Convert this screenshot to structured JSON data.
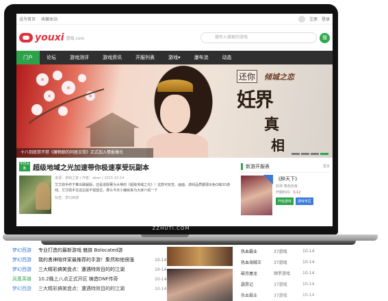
{
  "topbar": {
    "left": [
      "设为首页",
      "收藏本站"
    ],
    "login": "注册",
    "register": "登录"
  },
  "header": {
    "logo_text": "youxi",
    "logo_small": "游戏.com",
    "search_placeholder": "搜你入搜索的游戏",
    "search_button": "搜"
  },
  "nav": {
    "items": [
      {
        "label": "门户",
        "active": true
      },
      {
        "label": "论坛"
      },
      {
        "label": "游戏测评"
      },
      {
        "label": "游戏资讯"
      },
      {
        "label": "开服列表"
      },
      {
        "label": "游戏▾"
      },
      {
        "label": "瀑布流"
      },
      {
        "label": "动态"
      }
    ]
  },
  "banner": {
    "caption": "十八到底禁不禁《魔物娘的同居日常》正式加入情报爆光",
    "sign": "还你",
    "game_logo": "倾城之恋",
    "calligraphy": [
      "妊界",
      "真",
      "相"
    ]
  },
  "headline": {
    "tag": "今日头条",
    "title": "超级地域之光加速带你极速享受玩副本"
  },
  "article": {
    "meta": "来源：游戏之家 | 作者：dean | 2015-10-14",
    "summary": "艾艾助手终于推出破解版，还是追踪著为大神的《超级地域之光》！这款可玩性、画面、游戏品质都很出色Q萌3D游戏。艾艾助手在这边是不错首位，那么今天小编就来为大家介绍一下",
    "tags": "标签：梦幻西游"
  },
  "side": {
    "title": "新游开服表",
    "more": "更多",
    "game": {
      "name": "《醉天下》",
      "line1": "封测  角色扮演",
      "line2_label": "开服时间：",
      "line2_value": "3-12",
      "btn1": "开始游戏",
      "btn2": "游戏专区"
    }
  },
  "laptop_label": "ZZHUTI.COM",
  "lower_list": [
    {
      "cat": "梦幻西游",
      "text": "专业打造的最新游戏 魅族 Bolocated游",
      "date": "",
      "alt": false
    },
    {
      "cat": "梦幻西游",
      "text": "我的勇神陪伴家最推荐的手游！集然和他很强",
      "date": "10-14",
      "alt": false
    },
    {
      "cat": "梦幻西游",
      "text": "三大精彩搞笑盘点：遭遇特效目的的江湖",
      "date": "10-14",
      "alt": false
    },
    {
      "cat": "凤凰英雄",
      "text": "10.2晚上八点正式开区 铸造DNF传奇",
      "date": "10-14",
      "alt": true
    },
    {
      "cat": "梦幻西游",
      "text": "三大精彩搞笑盘点：遭遇特效目的的江湖",
      "date": "10-14",
      "alt": false
    }
  ],
  "lower_side": [
    {
      "a": "热血霸业",
      "b": "37游戏",
      "c": "10-14"
    },
    {
      "a": "热血海贼王",
      "b": "37游戏",
      "c": "10-14"
    },
    {
      "a": "破月屠龙",
      "b": "顺罗游戏",
      "c": "10-14"
    },
    {
      "a": "霹雳记",
      "b": "37游戏",
      "c": "10-14"
    },
    {
      "a": "热血霸业",
      "b": "37游戏",
      "c": "10-14"
    }
  ]
}
